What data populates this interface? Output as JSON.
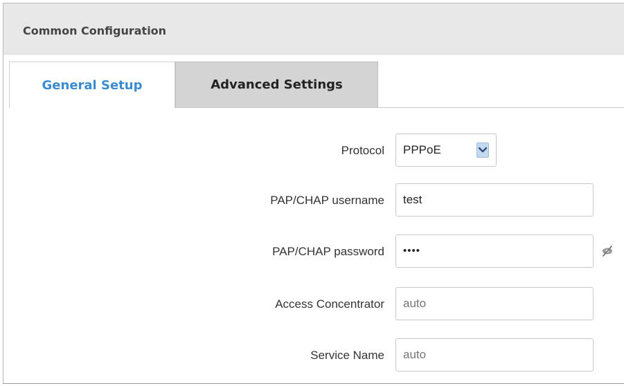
{
  "section": {
    "title": "Common Configuration"
  },
  "tabs": [
    {
      "label": "General Setup",
      "active": true
    },
    {
      "label": "Advanced Settings",
      "active": false
    }
  ],
  "form": {
    "protocol": {
      "label": "Protocol",
      "value": "PPPoE"
    },
    "username": {
      "label": "PAP/CHAP username",
      "value": "test"
    },
    "password": {
      "label": "PAP/CHAP password",
      "value": "••••"
    },
    "access_concentrator": {
      "label": "Access Concentrator",
      "placeholder": "auto"
    },
    "service_name": {
      "label": "Service Name",
      "placeholder": "auto"
    }
  },
  "icons": {
    "select_arrow": "chevron-down-icon",
    "password_reveal": "eye-off-icon"
  },
  "colors": {
    "active_tab_text": "#3a8bd0",
    "select_arrow_bg": "#c4d8ee",
    "header_bg": "#e8e8e8",
    "inactive_tab_bg": "#d4d4d4"
  }
}
